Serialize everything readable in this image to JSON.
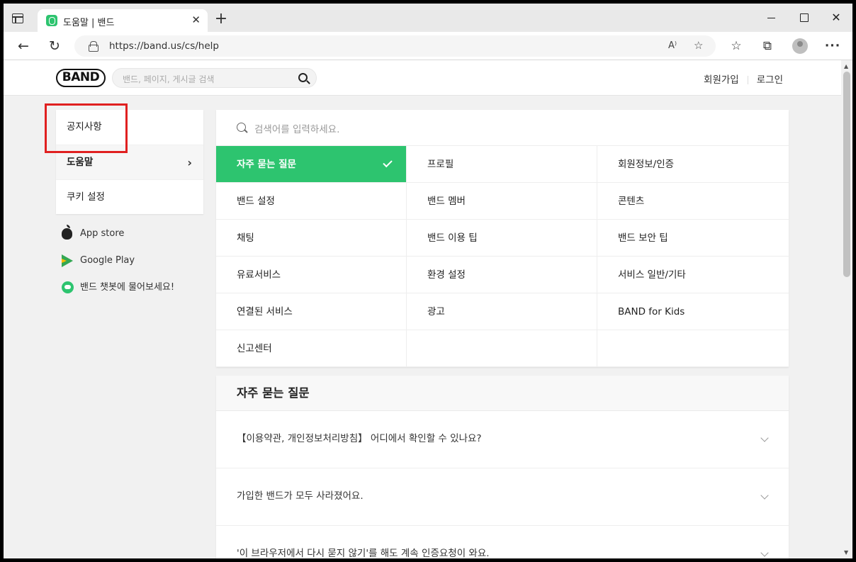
{
  "browser": {
    "tab_title": "도움말 | 밴드",
    "url": "https://band.us/cs/help"
  },
  "header": {
    "logo": "BAND",
    "search_placeholder": "밴드, 페이지, 게시글 검색",
    "signup": "회원가입",
    "login": "로그인"
  },
  "sidebar": {
    "items": [
      {
        "label": "공지사항"
      },
      {
        "label": "도움말"
      },
      {
        "label": "쿠키 설정"
      }
    ],
    "app_links": [
      {
        "label": "App store",
        "icon": "apple-icon"
      },
      {
        "label": "Google Play",
        "icon": "google-play-icon"
      },
      {
        "label": "밴드 챗봇에 물어보세요!",
        "icon": "chatbot-icon"
      }
    ]
  },
  "help": {
    "search_placeholder": "검색어를 입력하세요.",
    "categories": [
      "자주 묻는 질문",
      "프로필",
      "회원정보/인증",
      "밴드 설정",
      "밴드 멤버",
      "콘텐츠",
      "채팅",
      "밴드 이용 팁",
      "밴드 보안 팁",
      "유료서비스",
      "환경 설정",
      "서비스 일반/기타",
      "연결된 서비스",
      "광고",
      "BAND for Kids",
      "신고센터",
      "",
      ""
    ],
    "selected_category": "자주 묻는 질문"
  },
  "faq": {
    "title": "자주 묻는 질문",
    "items": [
      "【이용약관, 개인정보처리방침】 어디에서 확인할 수 있나요?",
      "가입한 밴드가 모두 사라졌어요.",
      "'이 브라우저에서 다시 묻지 않기'를 해도 계속 인증요청이 와요."
    ]
  },
  "colors": {
    "accent": "#2dc46f",
    "highlight": "#e02020"
  }
}
